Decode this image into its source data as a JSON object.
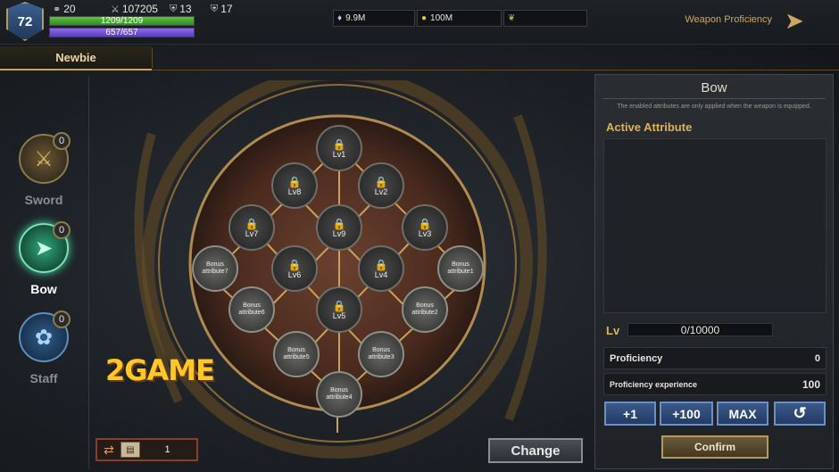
{
  "player": {
    "level": "72",
    "stat_a": "20",
    "power": "107205",
    "defense": "13",
    "shield": "17",
    "hp": "1209/1209",
    "mp": "657/657",
    "hp_fraction": 1.0,
    "mp_fraction": 1.0
  },
  "currencies": [
    {
      "icon": "diamond-icon",
      "value": "9.9M"
    },
    {
      "icon": "gold-coin-icon",
      "value": "100M"
    },
    {
      "icon": "feather-icon",
      "value": ""
    }
  ],
  "header": {
    "weapon_proficiency": "Weapon Proficiency"
  },
  "tabs": [
    {
      "label": "Newbie"
    }
  ],
  "weapons": [
    {
      "label": "Sword",
      "count": "0",
      "active": false
    },
    {
      "label": "Bow",
      "count": "0",
      "active": true
    },
    {
      "label": "Staff",
      "count": "0",
      "active": false
    }
  ],
  "tree_nodes": [
    {
      "label": "Lv1",
      "locked": true
    },
    {
      "label": "Lv8",
      "locked": true
    },
    {
      "label": "Lv2",
      "locked": true
    },
    {
      "label": "Lv7",
      "locked": true
    },
    {
      "label": "Lv9",
      "locked": true
    },
    {
      "label": "Lv3",
      "locked": true
    },
    {
      "label": "Bonus attribute7",
      "locked": false
    },
    {
      "label": "Lv6",
      "locked": true
    },
    {
      "label": "Lv4",
      "locked": true
    },
    {
      "label": "Bonus attribute1",
      "locked": false
    },
    {
      "label": "Bonus attribute6",
      "locked": false
    },
    {
      "label": "Lv5",
      "locked": true
    },
    {
      "label": "Bonus attribute2",
      "locked": false
    },
    {
      "label": "Bonus attribute5",
      "locked": false
    },
    {
      "label": "Bonus attribute3",
      "locked": false
    },
    {
      "label": "Bonus attribute4",
      "locked": false
    }
  ],
  "watermark": "2GAME",
  "bottom": {
    "item_count": "1",
    "change_label": "Change"
  },
  "panel": {
    "title": "Bow",
    "note": "The enabled attributes are only applied when the weapon is equipped.",
    "active_attribute": "Active Attribute",
    "lv_label": "Lv",
    "lv_value": "0/10000",
    "proficiency_label": "Proficiency",
    "proficiency_value": "0",
    "experience_label": "Proficiency experience",
    "experience_value": "100",
    "btn_plus1": "+1",
    "btn_plus100": "+100",
    "btn_max": "MAX",
    "confirm": "Confirm"
  }
}
